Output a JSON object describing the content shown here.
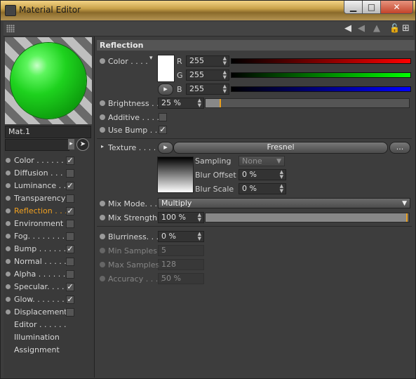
{
  "window": {
    "title": "Material Editor",
    "minimize_glyph": "▁",
    "maximize_glyph": "□",
    "close_glyph": "✕"
  },
  "toolbar": {
    "icons": [
      "grip-icon",
      "back-arrow-icon",
      "forward-arrow-icon",
      "up-arrow-icon",
      "lock-icon",
      "new-window-icon"
    ],
    "back_glyph": "◀",
    "forward_glyph": "◀",
    "up_glyph": "▲",
    "lock_glyph": "🔓",
    "new_glyph": "⊞"
  },
  "material": {
    "name": "Mat.1",
    "preview_color": "#1ed21e"
  },
  "channels": [
    {
      "label": "Color . . . . . .",
      "checked": true,
      "checkmark": "✓"
    },
    {
      "label": "Diffusion . . . .",
      "checked": false,
      "checkmark": ""
    },
    {
      "label": "Luminance . . .",
      "checked": true,
      "checkmark": "✓"
    },
    {
      "label": "Transparency",
      "checked": false,
      "checkmark": ""
    },
    {
      "label": "Reflection . . .",
      "checked": true,
      "checkmark": "✓",
      "active": true
    },
    {
      "label": "Environment",
      "checked": false,
      "checkmark": ""
    },
    {
      "label": "Fog. . . . . . . .",
      "checked": false,
      "checkmark": ""
    },
    {
      "label": "Bump . . . . . .",
      "checked": true,
      "checkmark": "✓"
    },
    {
      "label": "Normal . . . . .",
      "checked": false,
      "checkmark": ""
    },
    {
      "label": "Alpha . . . . . .",
      "checked": false,
      "checkmark": ""
    },
    {
      "label": "Specular. . . .",
      "checked": true,
      "checkmark": "✓"
    },
    {
      "label": "Glow. . . . . . .",
      "checked": true,
      "checkmark": "✓"
    },
    {
      "label": "Displacement",
      "checked": false,
      "checkmark": ""
    }
  ],
  "extra_items": [
    "Editor . . . . . .",
    "Illumination",
    "Assignment"
  ],
  "section": {
    "title": "Reflection"
  },
  "color": {
    "label": "Color . . . .",
    "swatch": "#ffffff",
    "r_label": "R",
    "r": "255",
    "g_label": "G",
    "g": "255",
    "b_label": "B",
    "b": "255",
    "expand_glyph": "▸",
    "dropdown_glyph": "▾"
  },
  "brightness": {
    "label": "Brightness . . .",
    "value": "25 %",
    "fraction": 0.25
  },
  "additive": {
    "label": "Additive . . . .",
    "checked": false,
    "checkmark": ""
  },
  "use_bump": {
    "label": "Use Bump . . .",
    "checked": true,
    "checkmark": "✓"
  },
  "texture": {
    "label": "Texture . . . . . .",
    "arrow_glyph": "▸",
    "shader": "Fresnel",
    "more_button": "...",
    "sampling_label": "Sampling",
    "sampling_value": "None",
    "blur_offset_label": "Blur Offset",
    "blur_offset": "0 %",
    "blur_scale_label": "Blur Scale",
    "blur_scale": "0 %"
  },
  "mix_mode": {
    "label": "Mix Mode. . . .",
    "value": "Multiply"
  },
  "mix_strength": {
    "label": "Mix Strength",
    "value": "100 %",
    "fraction": 1.0
  },
  "blurriness": {
    "label": "Blurriness. . . .",
    "value": "0 %"
  },
  "min_samples": {
    "label": "Min Samples",
    "value": "5"
  },
  "max_samples": {
    "label": "Max Samples",
    "value": "128"
  },
  "accuracy": {
    "label": "Accuracy . . . .",
    "value": "50 %"
  },
  "spin_glyph": "▲▼",
  "dropdown_arrow": "▼"
}
